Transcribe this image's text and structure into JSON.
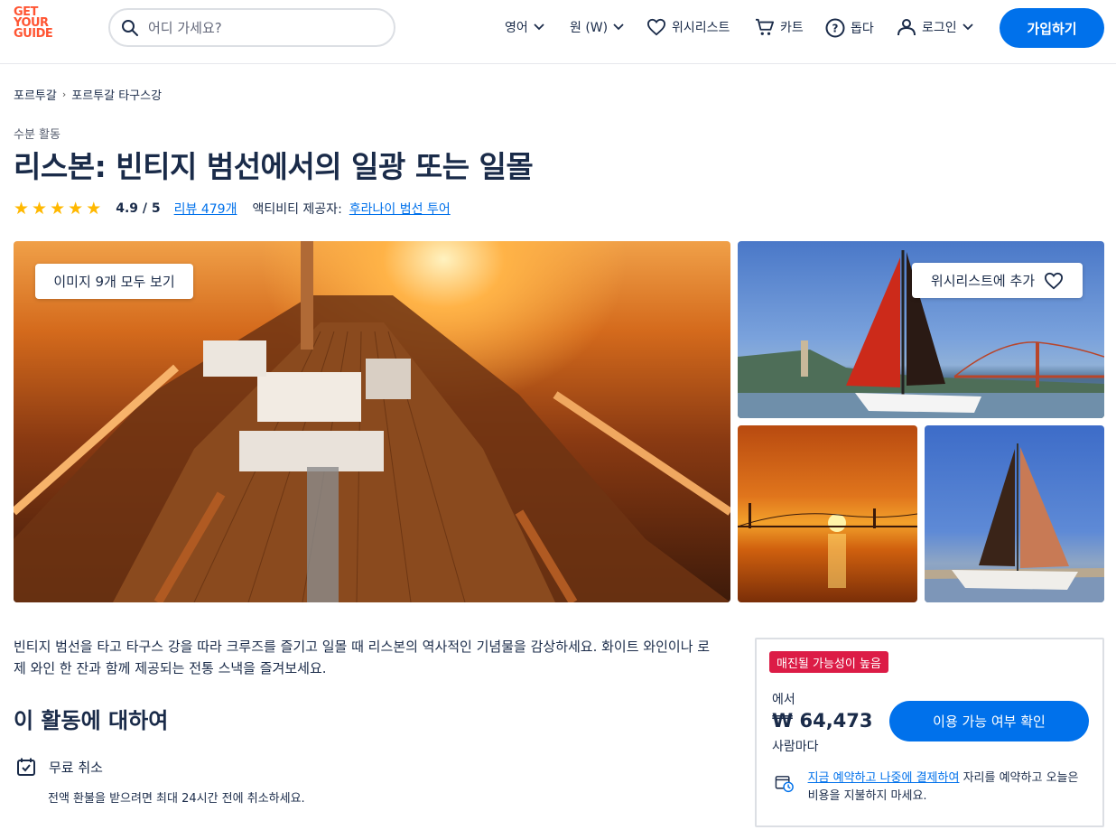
{
  "header": {
    "logo_lines": [
      "GET",
      "YOUR",
      "GUIDE"
    ],
    "search_placeholder": "어디 가세요?",
    "nav": {
      "language": "영어",
      "currency": "원 (W)",
      "wishlist": "위시리스트",
      "cart": "카트",
      "help": "돕다",
      "login": "로그인"
    },
    "signup_label": "가입하기"
  },
  "breadcrumb": [
    "포르투갈",
    "포르투갈 타구스강"
  ],
  "activity": {
    "category": "수분 활동",
    "title": "리스본: 빈티지 범선에서의 일광 또는 일몰",
    "rating": 4.9,
    "score_text": "4.9 / 5",
    "reviews_text": "리뷰 479개",
    "provider_label": "액티비티 제공자:",
    "provider_name": "후라나이 범선 투어"
  },
  "gallery": {
    "view_all_label": "이미지 9개 모두 보기",
    "wishlist_add_label": "위시리스트에 추가"
  },
  "description": "빈티지 범선을 타고 타구스 강을 따라 크루즈를 즐기고 일몰 때 리스본의 역사적인 기념물을 감상하세요. 화이트 와인이나 로제 와인 한 잔과 함께 제공되는 전통 스낵을 즐겨보세요.",
  "about": {
    "heading": "이 활동에 대하여",
    "free_cancel_title": "무료 취소",
    "free_cancel_desc": "전액 환불을 받으려면 최대 24시간 전에 취소하세요."
  },
  "booking": {
    "badge": "매진될 가능성이 높음",
    "from_label": "에서",
    "price": "₩ 64,473",
    "per_label": "사람마다",
    "check_label": "이용 가능 여부 확인",
    "reserve_link": "지금 예약하고 나중에 결제하여",
    "reserve_rest": " 자리를 예약하고 오늘은 비용을 지불하지 마세요."
  },
  "colors": {
    "primary": "#0071eb",
    "brand": "#ff5533",
    "badge": "#dc1c46",
    "star": "#ffb800",
    "text": "#1a2b49"
  }
}
